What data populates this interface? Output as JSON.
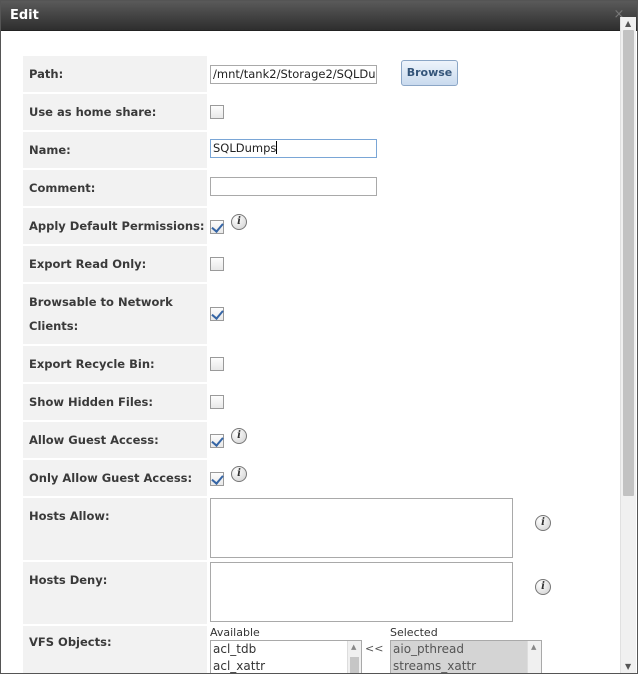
{
  "dialog": {
    "title": "Edit",
    "close_icon": "×"
  },
  "form": {
    "path": {
      "label": "Path:",
      "value": "/mnt/tank2/Storage2/SQLDu",
      "browse_label": "Browse"
    },
    "use_as_home_share": {
      "label": "Use as home share:",
      "checked": false
    },
    "name": {
      "label": "Name:",
      "value": "SQLDumps"
    },
    "comment": {
      "label": "Comment:",
      "value": ""
    },
    "apply_default_permissions": {
      "label": "Apply Default Permissions:",
      "checked": true,
      "info_icon": "i"
    },
    "export_read_only": {
      "label": "Export Read Only:",
      "checked": false
    },
    "browsable_to_network_clients": {
      "label_line1": "Browsable to Network",
      "label_line2": "Clients:",
      "checked": true
    },
    "export_recycle_bin": {
      "label": "Export Recycle Bin:",
      "checked": false
    },
    "show_hidden_files": {
      "label": "Show Hidden Files:",
      "checked": false
    },
    "allow_guest_access": {
      "label": "Allow Guest Access:",
      "checked": true,
      "info_icon": "i"
    },
    "only_allow_guest_access": {
      "label": "Only Allow Guest Access:",
      "checked": true,
      "info_icon": "i"
    },
    "hosts_allow": {
      "label": "Hosts Allow:",
      "value": "",
      "info_icon": "i"
    },
    "hosts_deny": {
      "label": "Hosts Deny:",
      "value": "",
      "info_icon": "i"
    },
    "vfs_objects": {
      "label": "VFS Objects:",
      "available_label": "Available",
      "selected_label": "Selected",
      "move_left": "<<",
      "available": [
        "acl_tdb",
        "acl_xattr"
      ],
      "selected": [
        "aio_pthread",
        "streams_xattr"
      ]
    }
  },
  "icons": {
    "close": "close-icon",
    "info": "info-icon",
    "scroll_up": "▲",
    "scroll_down": "▼"
  }
}
